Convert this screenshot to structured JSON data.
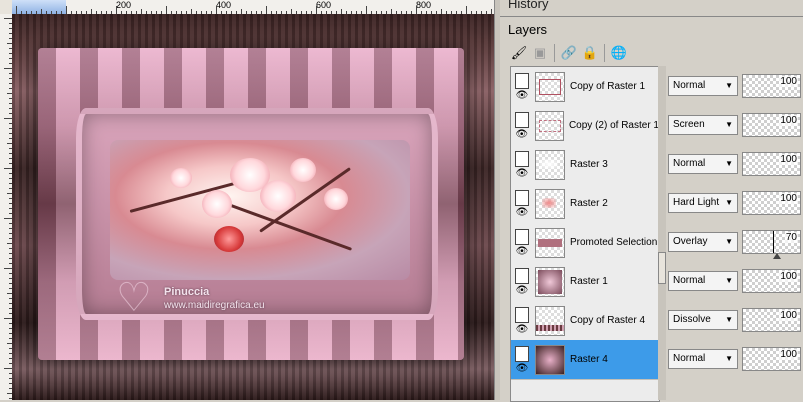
{
  "ruler": {
    "labels": [
      "200",
      "400",
      "600",
      "800"
    ]
  },
  "canvas": {
    "watermark_name": "Pinuccia",
    "watermark_site": "www.maidiregrafica.eu"
  },
  "panel": {
    "history_title": "History",
    "layers_title": "Layers",
    "tools": [
      "paint-icon",
      "mask-icon",
      "link-icon",
      "lock-icon",
      "globe-icon"
    ]
  },
  "layers": [
    {
      "name": "Copy of Raster 1",
      "blend": "Normal",
      "opacity": "100",
      "selected": false
    },
    {
      "name": "Copy (2) of Raster 1",
      "blend": "Screen",
      "opacity": "100",
      "selected": false
    },
    {
      "name": "Raster 3",
      "blend": "Normal",
      "opacity": "100",
      "selected": false
    },
    {
      "name": "Raster 2",
      "blend": "Hard Light",
      "opacity": "100",
      "selected": false
    },
    {
      "name": "Promoted Selection",
      "blend": "Overlay",
      "opacity": "70",
      "selected": false
    },
    {
      "name": "Raster 1",
      "blend": "Normal",
      "opacity": "100",
      "selected": false
    },
    {
      "name": "Copy of Raster 4",
      "blend": "Dissolve",
      "opacity": "100",
      "selected": false
    },
    {
      "name": "Raster 4",
      "blend": "Normal",
      "opacity": "100",
      "selected": true
    }
  ]
}
